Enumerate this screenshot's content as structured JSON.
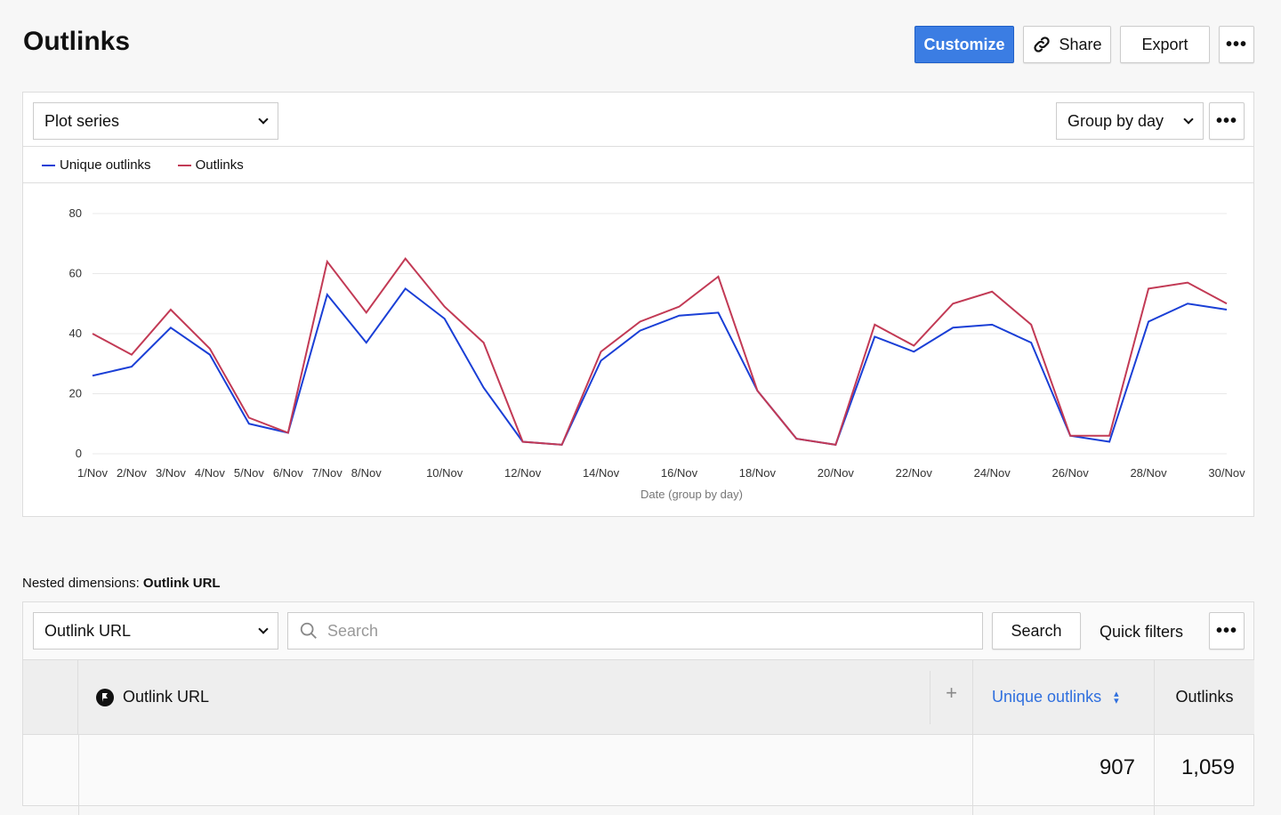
{
  "header": {
    "title": "Outlinks",
    "customize": "Customize",
    "share": "Share",
    "export": "Export",
    "more": "•••"
  },
  "chart_panel": {
    "plot_series": "Plot series",
    "group_by": "Group by day",
    "more": "•••"
  },
  "colors": {
    "accent": "#3b7de3",
    "unique": "#1a3fd6",
    "outlinks": "#c23a55"
  },
  "chart_data": {
    "type": "line",
    "xlabel": "Date (group by day)",
    "ylabel": "",
    "ylim": [
      0,
      80
    ],
    "yticks": [
      0,
      20,
      40,
      60,
      80
    ],
    "grid": true,
    "legend_placement": "top-left",
    "x": [
      "1/Nov",
      "2/Nov",
      "3/Nov",
      "4/Nov",
      "5/Nov",
      "6/Nov",
      "7/Nov",
      "8/Nov",
      "9/Nov",
      "10/Nov",
      "11/Nov",
      "12/Nov",
      "13/Nov",
      "14/Nov",
      "15/Nov",
      "16/Nov",
      "17/Nov",
      "18/Nov",
      "19/Nov",
      "20/Nov",
      "21/Nov",
      "22/Nov",
      "23/Nov",
      "24/Nov",
      "25/Nov",
      "26/Nov",
      "27/Nov",
      "28/Nov",
      "29/Nov",
      "30/Nov"
    ],
    "xtick_labels": [
      "1/Nov",
      "2/Nov",
      "3/Nov",
      "4/Nov",
      "5/Nov",
      "6/Nov",
      "7/Nov",
      "8/Nov",
      "",
      "10/Nov",
      "",
      "12/Nov",
      "",
      "14/Nov",
      "",
      "16/Nov",
      "",
      "18/Nov",
      "",
      "20/Nov",
      "",
      "22/Nov",
      "",
      "24/Nov",
      "",
      "26/Nov",
      "",
      "28/Nov",
      "",
      "30/Nov"
    ],
    "series": [
      {
        "name": "Unique outlinks",
        "color": "#1a3fd6",
        "values": [
          26,
          29,
          42,
          33,
          10,
          7,
          53,
          37,
          55,
          45,
          22,
          4,
          3,
          31,
          41,
          46,
          47,
          21,
          5,
          3,
          39,
          34,
          42,
          43,
          37,
          6,
          4,
          44,
          50,
          48
        ]
      },
      {
        "name": "Outlinks",
        "color": "#c23a55",
        "values": [
          40,
          33,
          48,
          35,
          12,
          7,
          64,
          47,
          65,
          49,
          37,
          4,
          3,
          34,
          44,
          49,
          59,
          21,
          5,
          3,
          43,
          36,
          50,
          54,
          43,
          6,
          6,
          55,
          57,
          50
        ]
      }
    ]
  },
  "nested": {
    "label": "Nested dimensions:",
    "value": "Outlink URL"
  },
  "table_panel": {
    "dimension": "Outlink URL",
    "search_placeholder": "Search",
    "search_button": "Search",
    "quick_filters": "Quick filters",
    "more": "•••"
  },
  "table": {
    "columns": [
      "Outlink URL",
      "Unique outlinks",
      "Outlinks"
    ],
    "add": "+",
    "totals": [
      "907",
      "1,059"
    ]
  }
}
